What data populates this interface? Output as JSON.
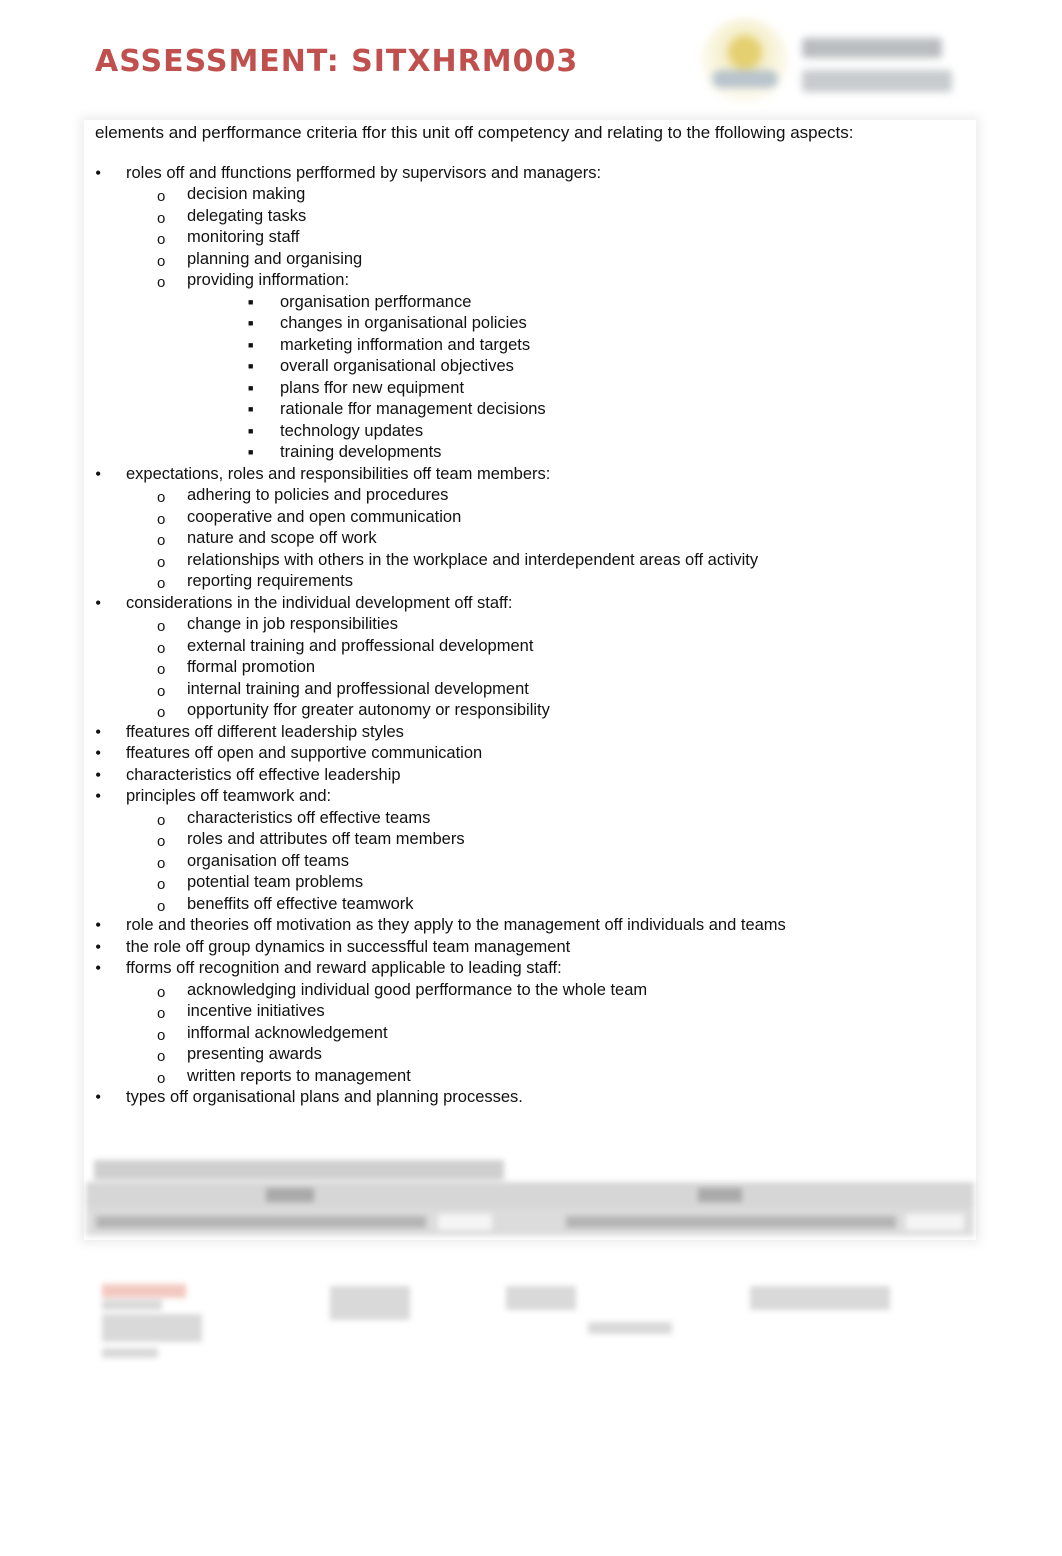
{
  "header": {
    "title": "ASSESSMENT: SITXHRM003",
    "logo_alt": "college-logo"
  },
  "content": {
    "intro": "elements and perfformance criteria ffor this unit off competency and relating to the ffollowing aspects:",
    "items": [
      {
        "text": "roles off and ffunctions perfformed by supervisors and managers:",
        "children": [
          {
            "text": "decision making"
          },
          {
            "text": "delegating tasks"
          },
          {
            "text": "monitoring staff"
          },
          {
            "text": "planning and organising"
          },
          {
            "text": "providing infformation:",
            "children": [
              "organisation perfformance",
              "changes in organisational policies",
              "marketing infformation and targets",
              "overall organisational objectives",
              "plans ffor new equipment",
              "rationale ffor management decisions",
              "technology updates",
              "training developments"
            ]
          }
        ]
      },
      {
        "text": "expectations, roles and responsibilities off team members:",
        "children": [
          {
            "text": "adhering to policies and procedures"
          },
          {
            "text": "cooperative and open communication"
          },
          {
            "text": "nature and scope off work"
          },
          {
            "text": "relationships with others in the workplace and interdependent areas off activity"
          },
          {
            "text": "reporting requirements"
          }
        ]
      },
      {
        "text": "considerations in the individual development off staff:",
        "children": [
          {
            "text": "change in job responsibilities"
          },
          {
            "text": "external training and proffessional development"
          },
          {
            "text": "fformal promotion"
          },
          {
            "text": "internal training and proffessional development"
          },
          {
            "text": "opportunity ffor greater autonomy or responsibility"
          }
        ]
      },
      {
        "text": "ffeatures off different leadership styles"
      },
      {
        "text": "ffeatures off open and supportive communication"
      },
      {
        "text": "characteristics off effective leadership"
      },
      {
        "text": "principles off teamwork and:",
        "children": [
          {
            "text": "characteristics off effective teams"
          },
          {
            "text": "roles and attributes off team members"
          },
          {
            "text": "organisation off teams"
          },
          {
            "text": "potential team problems"
          },
          {
            "text": "beneffits off effective teamwork"
          }
        ]
      },
      {
        "text": "role and theories off motivation as they apply to the management off individuals and teams"
      },
      {
        "text": "the role off group dynamics in successfful team management"
      },
      {
        "text": "fforms off recognition and reward applicable to leading staff:",
        "children": [
          {
            "text": "acknowledging individual good perfformance to the whole team"
          },
          {
            "text": "incentive initiatives"
          },
          {
            "text": "infformal acknowledgement"
          },
          {
            "text": "presenting awards"
          },
          {
            "text": "written reports to management"
          }
        ]
      },
      {
        "text": "types off organisational plans and planning processes."
      }
    ],
    "bullets": {
      "level1": "•",
      "level2": "o",
      "level3": "■"
    }
  },
  "colors": {
    "title": "#c0504d"
  }
}
